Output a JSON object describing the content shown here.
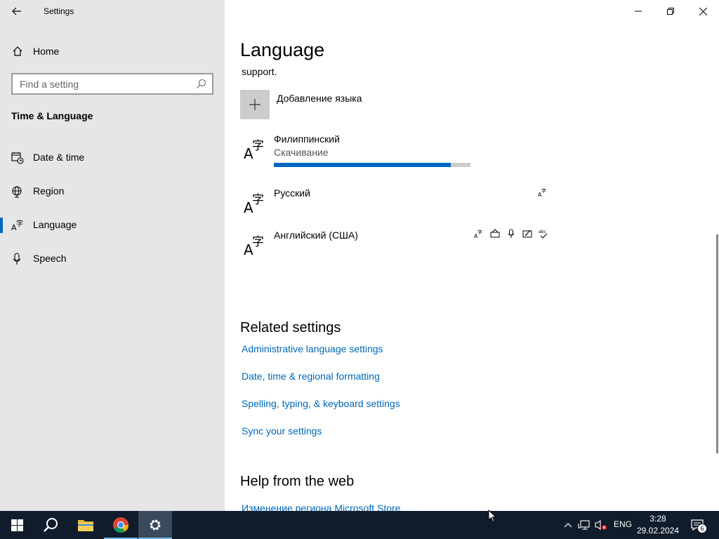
{
  "window": {
    "title": "Settings",
    "minimize_icon": "minimize-icon",
    "restore_icon": "restore-icon",
    "close_icon": "close-icon"
  },
  "sidebar": {
    "home_label": "Home",
    "search_placeholder": "Find a setting",
    "section_title": "Time & Language",
    "items": [
      {
        "label": "Date & time",
        "icon": "calendar-clock-icon"
      },
      {
        "label": "Region",
        "icon": "globe-icon"
      },
      {
        "label": "Language",
        "icon": "language-icon",
        "active": true
      },
      {
        "label": "Speech",
        "icon": "microphone-icon"
      }
    ]
  },
  "main": {
    "title": "Language",
    "support_text": "support.",
    "add_language_label": "Добавление языка",
    "languages": [
      {
        "name": "Филиппинский",
        "status": "Скачивание",
        "progress": 0.9
      },
      {
        "name": "Русский"
      },
      {
        "name": "Английский (США)"
      }
    ],
    "related_heading": "Related settings",
    "related_links": [
      "Administrative language settings",
      "Date, time & regional formatting",
      "Spelling, typing, & keyboard settings",
      "Sync your settings"
    ],
    "help_heading": "Help from the web",
    "help_link": "Изменение региона Microsoft Store"
  },
  "taskbar": {
    "language": "ENG",
    "time": "3:28",
    "date": "29.02.2024",
    "notification_count": "6"
  },
  "colors": {
    "accent": "#0067c0",
    "link": "#0067b8",
    "sidebar_bg": "#e6e6e6",
    "taskbar_bg": "#101c2b"
  }
}
